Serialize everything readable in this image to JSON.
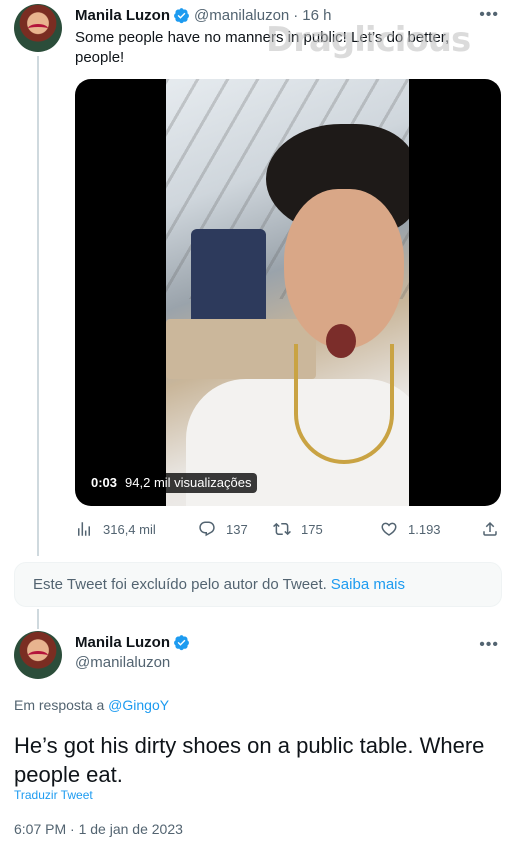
{
  "tweet1": {
    "display_name": "Manila Luzon",
    "handle": "@manilaluzon",
    "separator": "·",
    "time_ago": "16 h",
    "text": "Some people have no manners in public! Let’s do better, people!",
    "watermark": "Draglicious",
    "video": {
      "duration": "0:03",
      "views": "94,2 mil visualizações"
    },
    "stats": {
      "views": "316,4 mil",
      "replies": "137",
      "retweets": "175",
      "likes": "1.193"
    }
  },
  "deleted_notice": {
    "text": "Este Tweet foi excluído pelo autor do Tweet.",
    "link": "Saiba mais"
  },
  "tweet2": {
    "display_name": "Manila Luzon",
    "handle": "@manilaluzon",
    "reply_prefix": "Em resposta a",
    "reply_mention": "@GingoY",
    "text": "He’s got his dirty shoes on a public table. Where people eat.",
    "translate": "Traduzir Tweet",
    "timestamp": "6:07 PM · 1 de jan de 2023"
  },
  "colors": {
    "accent": "#1d9bf0",
    "muted": "#536471",
    "text": "#0f1419"
  }
}
